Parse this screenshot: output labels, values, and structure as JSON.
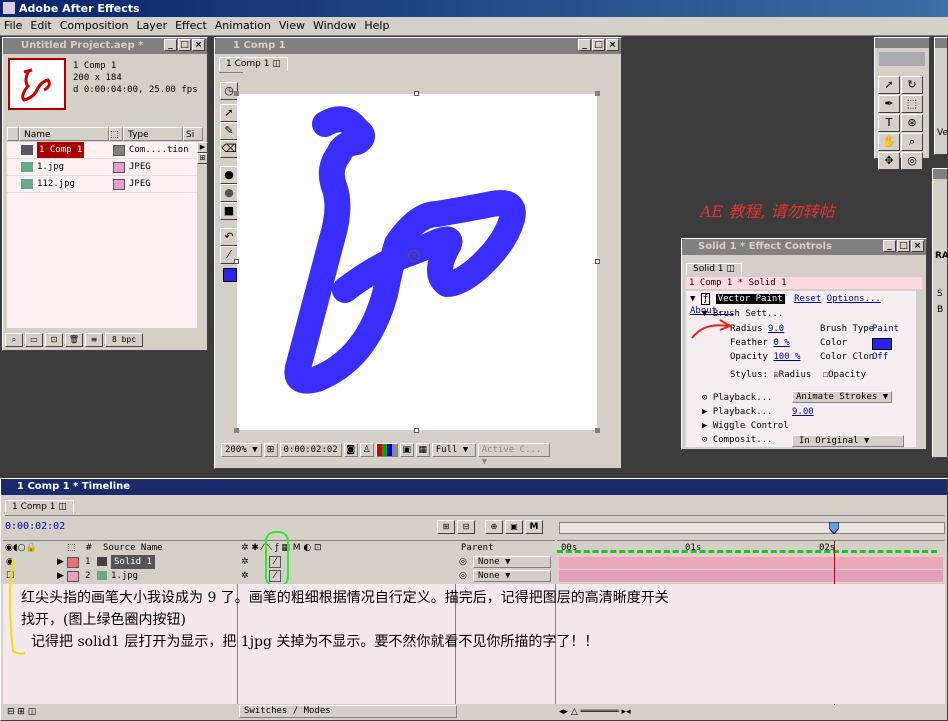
{
  "app": {
    "title": "Adobe After Effects"
  },
  "menu": [
    "File",
    "Edit",
    "Composition",
    "Layer",
    "Effect",
    "Animation",
    "View",
    "Window",
    "Help"
  ],
  "project": {
    "title": "Untitled Project.aep *",
    "info_name": "1 Comp 1",
    "info_size": "200 x 184",
    "info_duration": "d 0:00:04:00, 25.00 fps",
    "col_name": "Name",
    "col_type": "Type",
    "col_size": "Si",
    "items": [
      {
        "name": "1 Comp 1",
        "type": "Com....tion",
        "color": "#808080"
      },
      {
        "name": "1.jpg",
        "type": "JPEG",
        "color": "#e8a0c8"
      },
      {
        "name": "112.jpg",
        "type": "JPEG",
        "color": "#e8a0c8"
      }
    ],
    "bpc": "8 bpc"
  },
  "comp": {
    "title": "1 Comp 1",
    "tab": "1 Comp 1",
    "zoom": "200%",
    "timecode": "0:00:02:02",
    "resolution": "Full",
    "camera": "Active C...",
    "stroke_color": "#3a2eff"
  },
  "watermark": "AE 教程, 请勿转帖",
  "effects": {
    "title": "Solid 1 * Effect Controls",
    "tab": "Solid 1",
    "path": "1 Comp 1 * Solid 1",
    "effect_name": "Vector Paint",
    "reset": "Reset",
    "options": "Options...",
    "about": "About...",
    "brush_settings": "Brush Sett...",
    "radius_label": "Radius",
    "radius_value": "9.0",
    "brush_type_label": "Brush Type",
    "brush_type_value": "Paint",
    "feather_label": "Feather",
    "feather_value": "0 %",
    "color_label": "Color",
    "color_value": "#2d22e8",
    "opacity_label": "Opacity",
    "opacity_value": "100 %",
    "clone_label": "Color Clon",
    "clone_value": "Off",
    "stylus_label": "Stylus:",
    "stylus_radius": "Radius",
    "stylus_opacity": "Opacity",
    "playback1": "Playback...",
    "playback1_value": "Animate Strokes",
    "playback2": "Playback...",
    "playback2_value": "9.00",
    "wiggle": "Wiggle Control",
    "composite": "Composit...",
    "composite_value": "In Original"
  },
  "timeline": {
    "title": "1 Comp 1 * Timeline",
    "tab": "1 Comp 1",
    "timecode": "0:00:02:02",
    "col_source": "Source Name",
    "col_parent": "Parent",
    "switches": "Switches / Modes",
    "ruler": [
      "00s",
      "01s",
      "02s"
    ],
    "layers": [
      {
        "num": "1",
        "name": "Solid 1",
        "parent": "None",
        "color": "#e87070"
      },
      {
        "num": "2",
        "name": "1.jpg",
        "parent": "None",
        "color": "#e8a0c8"
      }
    ]
  },
  "notes": {
    "line1": "红尖头指的画笔大小我设成为 9 了。画笔的粗细根据情况自行定义。描完后，记得把图层的高清晰度开关",
    "line2": "找开，(图上绿色圈内按钮)",
    "line3": "记得把 solid1 层打开为显示，把 1jpg 关掉为不显示。要不然你就看不见你所描的字了！！"
  },
  "right_panel": {
    "label_ve": "Ve",
    "label_ra": "RA",
    "label_s": "S",
    "label_b": "B"
  }
}
